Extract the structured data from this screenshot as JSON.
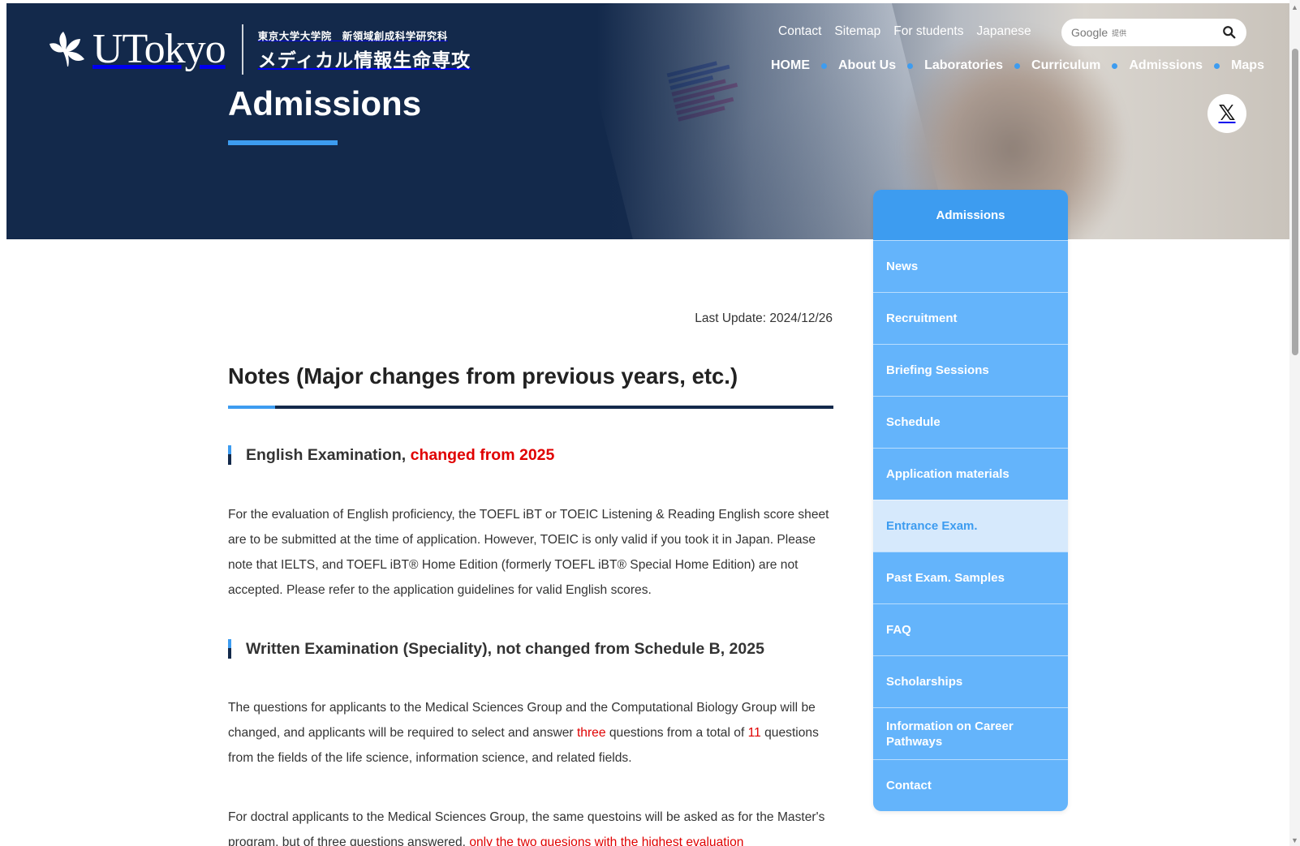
{
  "header": {
    "logo_text": "UTokyo",
    "logo_jp_line1": "東京大学大学院　新領域創成科学研究科",
    "logo_jp_line2": "メディカル情報生命専攻",
    "page_title": "Admissions",
    "util_links": [
      "Contact",
      "Sitemap",
      "For students",
      "Japanese"
    ],
    "search": {
      "brand": "Google",
      "brand_sub": "提供",
      "value": "",
      "icon": "search-icon"
    },
    "main_nav": [
      "HOME",
      "About Us",
      "Laboratories",
      "Curriculum",
      "Admissions",
      "Maps"
    ],
    "social": {
      "icon": "x-twitter-icon",
      "glyph": "𝕏"
    }
  },
  "sidebar": {
    "heading": "Admissions",
    "items": [
      {
        "label": "News",
        "active": false
      },
      {
        "label": "Recruitment",
        "active": false
      },
      {
        "label": "Briefing Sessions",
        "active": false
      },
      {
        "label": "Schedule",
        "active": false
      },
      {
        "label": "Application materials",
        "active": false
      },
      {
        "label": "Entrance Exam.",
        "active": true
      },
      {
        "label": "Past Exam. Samples",
        "active": false
      },
      {
        "label": "FAQ",
        "active": false
      },
      {
        "label": "Scholarships",
        "active": false
      },
      {
        "label": "Information on Career Pathways",
        "active": false
      },
      {
        "label": "Contact",
        "active": false
      }
    ]
  },
  "content": {
    "last_update": "Last Update: 2024/12/26",
    "section_title": "Notes (Major changes from previous years, etc.)",
    "english": {
      "heading": "English Examination, ",
      "heading_highlight": "changed from 2025",
      "body": "For the evaluation of English proficiency, the TOEFL iBT or TOEIC Listening & Reading English score sheet are to be submitted at the time of application. However, TOEIC is only valid if you took it in Japan. Please note that IELTS, and TOEFL iBT® Home Edition (formerly TOEFL iBT® Special Home Edition) are not accepted. Please refer to the application guidelines for valid English scores."
    },
    "written": {
      "heading": "Written Examination (Speciality), not changed from Schedule B, 2025",
      "body_part1": "The questions for applicants to the Medical Sciences Group and the Computational Biology Group will be changed, and applicants will be required to select and answer ",
      "body_highlight1": "three",
      "body_part2": " questions from a total of ",
      "body_highlight2": "11",
      "body_part3": " questions from the fields of the life science, information science, and related fields."
    },
    "doctoral": {
      "body_part1": "For doctral applicants to the Medical Sciences Group, the same questoins will be asked as for the Master's program, but of three questions answered, ",
      "body_highlight": "only the two quesions with the highest evaluation"
    }
  },
  "colors": {
    "navy": "#13294b",
    "accent_blue": "#3d9cf0",
    "menu_blue": "#64b4fb",
    "menu_active_bg": "#d6e9fc",
    "highlight_red": "#e00000"
  }
}
